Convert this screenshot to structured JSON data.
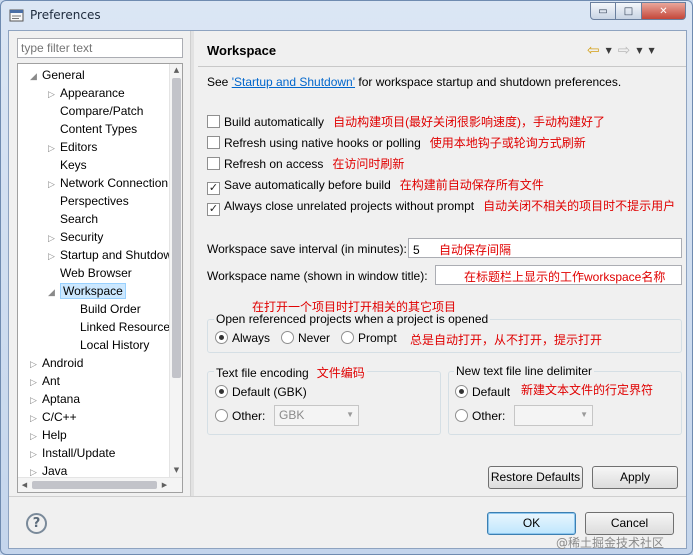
{
  "window": {
    "title": "Preferences"
  },
  "title_controls": {
    "minimize": "▭",
    "maximize": "□",
    "close": "✕"
  },
  "filter": {
    "placeholder": "type filter text"
  },
  "tree": [
    {
      "label": "General",
      "level": 0,
      "expanded": true
    },
    {
      "label": "Appearance",
      "level": 1,
      "expandable": true
    },
    {
      "label": "Compare/Patch",
      "level": 1
    },
    {
      "label": "Content Types",
      "level": 1
    },
    {
      "label": "Editors",
      "level": 1,
      "expandable": true
    },
    {
      "label": "Keys",
      "level": 1
    },
    {
      "label": "Network Connection",
      "level": 1,
      "expandable": true
    },
    {
      "label": "Perspectives",
      "level": 1
    },
    {
      "label": "Search",
      "level": 1
    },
    {
      "label": "Security",
      "level": 1,
      "expandable": true
    },
    {
      "label": "Startup and Shutdown",
      "level": 1,
      "expandable": true
    },
    {
      "label": "Web Browser",
      "level": 1
    },
    {
      "label": "Workspace",
      "level": 1,
      "expanded": true,
      "selected": true
    },
    {
      "label": "Build Order",
      "level": 2
    },
    {
      "label": "Linked Resources",
      "level": 2
    },
    {
      "label": "Local History",
      "level": 2
    },
    {
      "label": "Android",
      "level": 0,
      "expandable": true
    },
    {
      "label": "Ant",
      "level": 0,
      "expandable": true
    },
    {
      "label": "Aptana",
      "level": 0,
      "expandable": true
    },
    {
      "label": "C/C++",
      "level": 0,
      "expandable": true
    },
    {
      "label": "Help",
      "level": 0,
      "expandable": true
    },
    {
      "label": "Install/Update",
      "level": 0,
      "expandable": true
    },
    {
      "label": "Java",
      "level": 0,
      "expandable": true
    }
  ],
  "page": {
    "title": "Workspace",
    "intro_prefix": "See ",
    "intro_link": "'Startup and Shutdown'",
    "intro_suffix": " for workspace startup and shutdown preferences."
  },
  "checkboxes": [
    {
      "label": "Build automatically",
      "checked": false,
      "note": "自动构建项目(最好关闭很影响速度)，手动构建好了"
    },
    {
      "label": "Refresh using native hooks or polling",
      "checked": false,
      "note": "使用本地钩子或轮询方式刷新"
    },
    {
      "label": "Refresh on access",
      "checked": false,
      "note": "在访问时刷新"
    },
    {
      "label": "Save automatically before build",
      "checked": true,
      "note": "在构建前自动保存所有文件"
    },
    {
      "label": "Always close unrelated projects without prompt",
      "checked": true,
      "note": "自动关闭不相关的项目时不提示用户"
    }
  ],
  "save_interval": {
    "label": "Workspace save interval (in minutes):",
    "value": "5",
    "note": "自动保存间隔"
  },
  "workspace_name": {
    "label": "Workspace name (shown in window title):",
    "value": "",
    "note": "在标题栏上显示的工作workspace名称"
  },
  "open_referenced": {
    "note": "在打开一个项目时打开相关的其它项目",
    "label": "Open referenced projects when a project is opened",
    "options": [
      "Always",
      "Never",
      "Prompt"
    ],
    "selected": "Always",
    "options_note": "总是自动打开，从不打开，提示打开"
  },
  "encoding": {
    "label": "Text file encoding",
    "note": "文件编码",
    "default_label": "Default (GBK)",
    "other_label": "Other:",
    "other_value": "GBK",
    "selected": "default"
  },
  "line_delimiter": {
    "label": "New text file line delimiter",
    "default_label": "Default",
    "note": "新建文本文件的行定界符",
    "other_label": "Other:",
    "other_value": "",
    "selected": "default"
  },
  "buttons": {
    "restore": "Restore Defaults",
    "apply": "Apply",
    "ok": "OK",
    "cancel": "Cancel"
  },
  "help": {
    "glyph": "?"
  },
  "watermark": "@稀土掘金技术社区",
  "colors": {
    "annotation": "#e00000",
    "link": "#0066cc",
    "selection": "#cce8ff"
  }
}
